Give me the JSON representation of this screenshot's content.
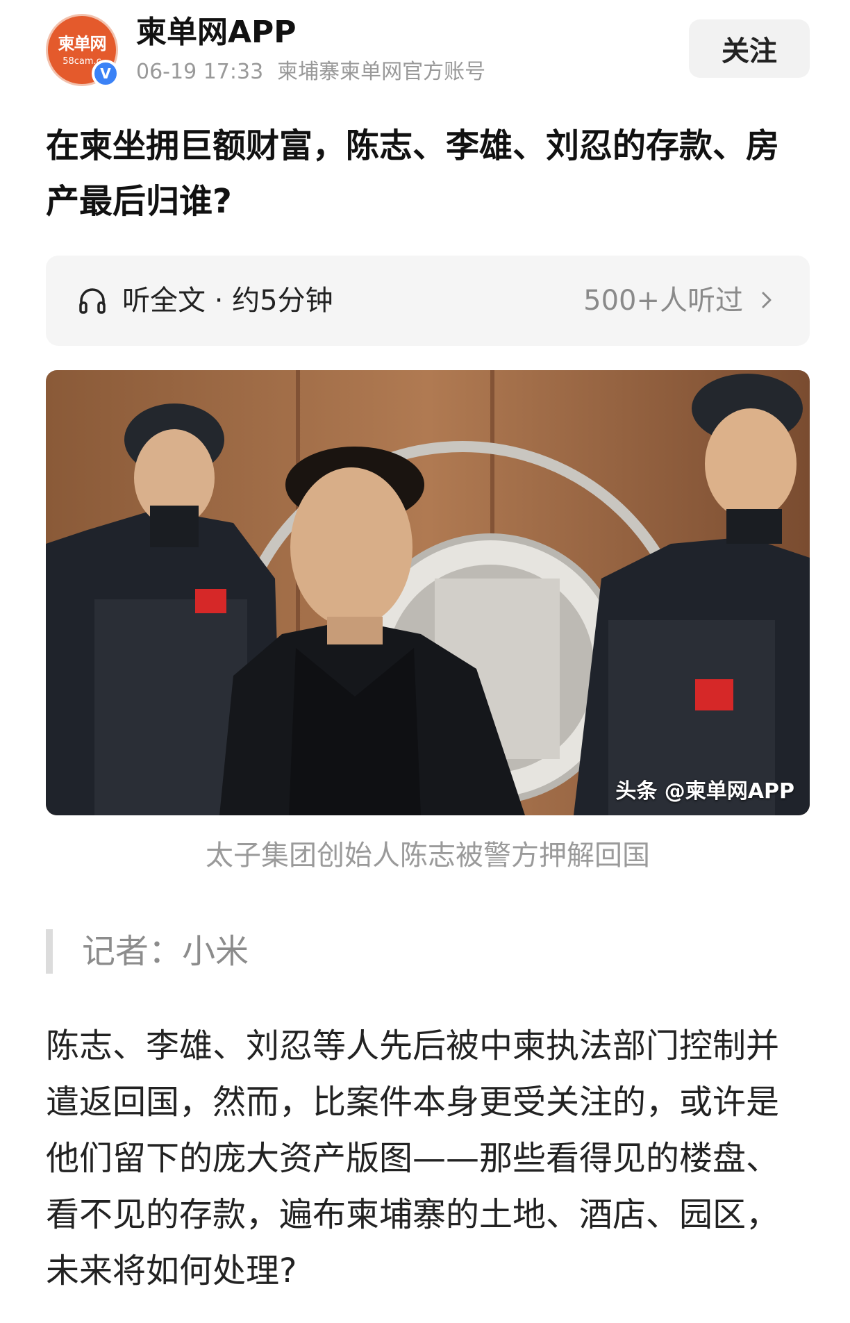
{
  "header": {
    "avatar_logo": "柬单网",
    "avatar_sub": "58cam.c",
    "verified_mark": "V",
    "account_name": "柬单网APP",
    "timestamp": "06-19 17:33",
    "account_desc": "柬埔寨柬单网官方账号",
    "follow_label": "关注"
  },
  "article": {
    "title": "在柬坐拥巨额财富，陈志、李雄、刘忍的存款、房产最后归谁?"
  },
  "listen": {
    "label": "听全文 · 约5分钟",
    "count": "500+人听过",
    "icon": "headphones-icon",
    "chevron": "chevron-right-icon"
  },
  "photo": {
    "watermark": "头条 @柬单网APP",
    "caption": "太子集团创始人陈志被警方押解回国"
  },
  "reporter": {
    "label": "记者：小米"
  },
  "body": {
    "paragraph": "陈志、李雄、刘忍等人先后被中柬执法部门控制并遣返回国，然而，比案件本身更受关注的，或许是他们留下的庞大资产版图——那些看得见的楼盘、看不见的存款，遍布柬埔寨的土地、酒店、园区，未来将如何处理?"
  },
  "colors": {
    "brand_orange": "#e45a2c",
    "verified_blue": "#3b82f6",
    "muted_text": "#999999"
  }
}
